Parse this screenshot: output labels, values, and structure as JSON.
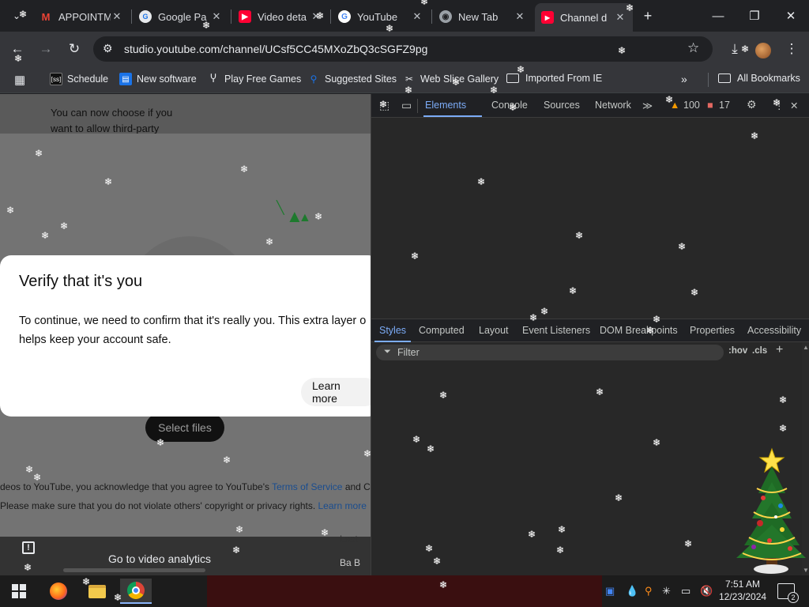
{
  "tabs": [
    {
      "title": "APPOINTM",
      "icon": "gmail-icon",
      "color": "#ea4335"
    },
    {
      "title": "Google Pa",
      "icon": "google-pay-icon",
      "color": "#8ab4f8"
    },
    {
      "title": "Video deta",
      "icon": "youtube-studio-icon",
      "color": "#ff0033"
    },
    {
      "title": "YouTube",
      "icon": "google-icon",
      "color": "#4285f4"
    },
    {
      "title": "New Tab",
      "icon": "chrome-icon",
      "color": "#9aa0a6"
    },
    {
      "title": "Channel d",
      "icon": "youtube-icon",
      "color": "#ff0033"
    }
  ],
  "toolbar": {
    "url": "studio.youtube.com/channel/UCsf5CC45MXoZbQ3cSGFZ9pg"
  },
  "bookmarks": {
    "items": [
      {
        "label": "Schedule",
        "icon": "schedule-icon"
      },
      {
        "label": "New software",
        "icon": "software-icon"
      },
      {
        "label": "Play Free Games",
        "icon": "games-icon"
      },
      {
        "label": "Suggested Sites",
        "icon": "suggested-icon"
      },
      {
        "label": "Web Slice Gallery",
        "icon": "web-slice-icon"
      },
      {
        "label": "Imported From IE",
        "icon": "folder-icon"
      }
    ],
    "all_label": "All Bookmarks"
  },
  "page": {
    "notice_line1": "You can now choose if you",
    "notice_line2": "want to allow third-party",
    "verify_title": "Verify that it's you",
    "verify_body_line1": "To continue, we need to confirm that it's really you. This extra layer o",
    "verify_body_line2": "helps keep your account safe.",
    "learn_more": "Learn more",
    "select_files": "Select files",
    "terms_line1_prefix": "deos to YouTube, you acknowledge that you agree to YouTube's ",
    "terms_line1_link": "Terms of Service",
    "terms_line1_suffix": " and C",
    "terms_line2_prefix": "Please make sure that you do not violate others' copyright or privacy rights. ",
    "terms_line2_link": "Learn more",
    "go_analytics": "Go to video analytics",
    "side_text1": "Last",
    "side_text2": "Ba B"
  },
  "devtools": {
    "top_tabs": [
      "Elements",
      "Console",
      "Sources",
      "Network"
    ],
    "warnings": "100",
    "errors": "17",
    "sub_tabs": [
      "Styles",
      "Computed",
      "Layout",
      "Event Listeners",
      "DOM Breakpoints",
      "Properties",
      "Accessibility"
    ],
    "filter_placeholder": "Filter",
    "hov": ":hov",
    "cls": ".cls"
  },
  "taskbar": {
    "time": "7:51 AM",
    "date": "12/23/2024",
    "notifications": "2"
  },
  "colors": {
    "accent": "#7cacf8",
    "warning": "#f29900",
    "error": "#e46962",
    "youtube_red": "#ff0033"
  }
}
